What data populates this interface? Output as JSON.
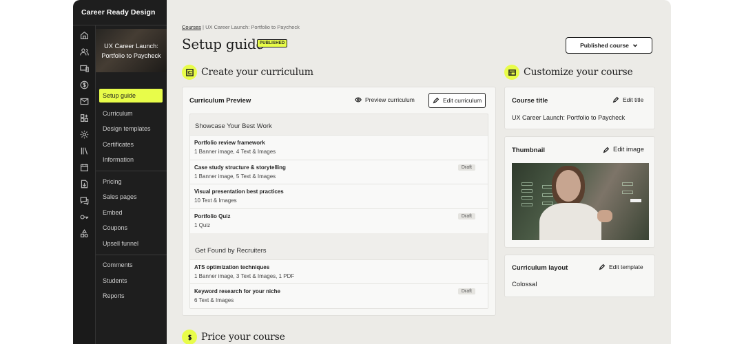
{
  "brand": "Career Ready Design",
  "course": {
    "thumb_title": "UX Career Launch: Portfolio to Paycheck"
  },
  "sidebar": {
    "group1": [
      "Setup guide",
      "Curriculum",
      "Design templates",
      "Certificates",
      "Information"
    ],
    "group2": [
      "Pricing",
      "Sales pages",
      "Embed",
      "Coupons",
      "Upsell funnel"
    ],
    "group3": [
      "Comments",
      "Students",
      "Reports"
    ]
  },
  "rail_icons": [
    "home-icon",
    "users-icon",
    "devices-icon",
    "dollar-icon",
    "mail-icon",
    "apps-icon",
    "gear-icon",
    "library-icon",
    "calendar-icon",
    "download-icon",
    "chat-icon",
    "key-icon",
    "shapes-icon"
  ],
  "breadcrumb": {
    "root": "Courses",
    "sep": "|",
    "current": "UX Career Launch: Portfolio to Paycheck"
  },
  "page": {
    "title": "Setup guide",
    "badge": "PUBLISHED",
    "status_button": "Published course"
  },
  "sections": {
    "curriculum": "Create your curriculum",
    "customize": "Customize your course",
    "price": "Price your course"
  },
  "curriculum_card": {
    "title": "Curriculum Preview",
    "preview": "Preview curriculum",
    "edit": "Edit curriculum",
    "groups": [
      {
        "title": "Showcase Your Best Work",
        "lessons": [
          {
            "title": "Portfolio review framework",
            "meta": "1 Banner image, 4 Text & Images",
            "badge": ""
          },
          {
            "title": "Case study structure & storytelling",
            "meta": "1 Banner image, 5 Text & Images",
            "badge": "Draft"
          },
          {
            "title": "Visual presentation best practices",
            "meta": "10 Text & Images",
            "badge": ""
          },
          {
            "title": "Portfolio Quiz",
            "meta": "1 Quiz",
            "badge": "Draft"
          }
        ]
      },
      {
        "title": "Get Found by Recruiters",
        "lessons": [
          {
            "title": "ATS optimization techniques",
            "meta": "1 Banner image, 3 Text & Images, 1 PDF",
            "badge": ""
          },
          {
            "title": "Keyword research for your niche",
            "meta": "6 Text & Images",
            "badge": "Draft"
          }
        ]
      }
    ]
  },
  "course_title_card": {
    "title": "Course title",
    "action": "Edit title",
    "value": "UX Career Launch: Portfolio to Paycheck"
  },
  "thumbnail_card": {
    "title": "Thumbnail",
    "action": "Edit image"
  },
  "layout_card": {
    "title": "Curriculum layout",
    "action": "Edit template",
    "value": "Colossal"
  },
  "colors": {
    "accent": "#e8fc4a",
    "sidebar": "#1e1e1e",
    "canvas": "#ecebe7"
  }
}
